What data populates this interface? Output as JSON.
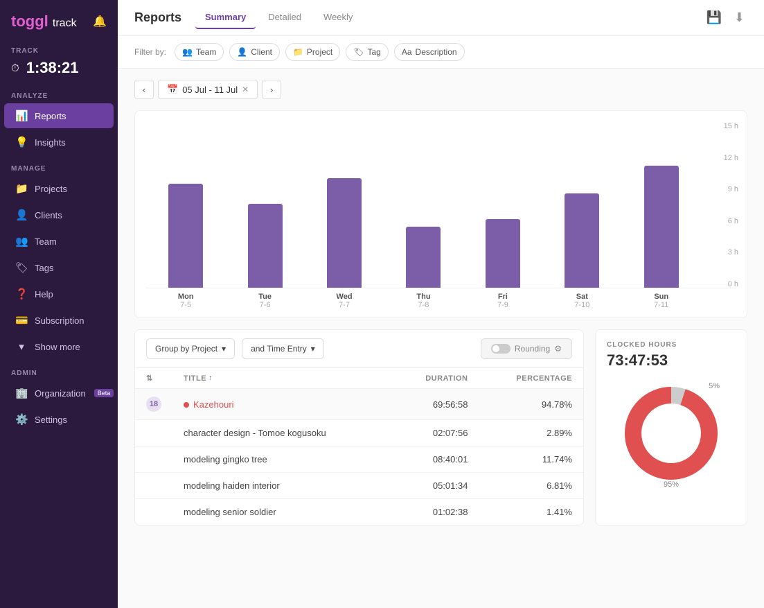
{
  "app": {
    "logo": "toggl",
    "logo_track": "track"
  },
  "sidebar": {
    "track_label": "TRACK",
    "timer": "1:38:21",
    "analyze_label": "ANALYZE",
    "manage_label": "MANAGE",
    "admin_label": "ADMIN",
    "items": {
      "reports": "Reports",
      "insights": "Insights",
      "projects": "Projects",
      "clients": "Clients",
      "team": "Team",
      "tags": "Tags",
      "help": "Help",
      "subscription": "Subscription",
      "show_more": "Show more",
      "organization": "Organization",
      "organization_badge": "Beta",
      "settings": "Settings"
    }
  },
  "header": {
    "page_title": "Reports",
    "tabs": [
      "Summary",
      "Detailed",
      "Weekly"
    ],
    "active_tab": "Summary"
  },
  "filter_bar": {
    "label": "Filter by:",
    "filters": [
      "Team",
      "Client",
      "Project",
      "Tag",
      "Description"
    ]
  },
  "date_nav": {
    "range": "05 Jul - 11 Jul"
  },
  "chart": {
    "y_labels": [
      "15 h",
      "12 h",
      "9 h",
      "6 h",
      "3 h",
      "0 h"
    ],
    "bars": [
      {
        "day": "Mon",
        "date": "7-5",
        "height_pct": 68
      },
      {
        "day": "Tue",
        "date": "7-6",
        "height_pct": 55
      },
      {
        "day": "Wed",
        "date": "7-7",
        "height_pct": 72
      },
      {
        "day": "Thu",
        "date": "7-8",
        "height_pct": 40
      },
      {
        "day": "Fri",
        "date": "7-9",
        "height_pct": 45
      },
      {
        "day": "Sat",
        "date": "7-10",
        "height_pct": 62
      },
      {
        "day": "Sun",
        "date": "7-11",
        "height_pct": 80
      }
    ]
  },
  "table": {
    "group_by": "Group by Project",
    "time_entry": "and Time Entry",
    "rounding": "Rounding",
    "columns": {
      "title": "TITLE",
      "duration": "DURATION",
      "percentage": "PERCENTAGE"
    },
    "rows": [
      {
        "type": "project",
        "count": "18",
        "name": "Kazehouri",
        "duration": "69:56:58",
        "percentage": "94.78%"
      },
      {
        "type": "entry",
        "name": "character design - Tomoe kogusoku",
        "duration": "02:07:56",
        "percentage": "2.89%"
      },
      {
        "type": "entry",
        "name": "modeling gingko tree",
        "duration": "08:40:01",
        "percentage": "11.74%"
      },
      {
        "type": "entry",
        "name": "modeling haiden interior",
        "duration": "05:01:34",
        "percentage": "6.81%"
      },
      {
        "type": "entry",
        "name": "modeling senior soldier",
        "duration": "01:02:38",
        "percentage": "1.41%"
      }
    ]
  },
  "clocked": {
    "label": "CLOCKED HOURS",
    "time": "73:47:53",
    "donut": {
      "pct_small": "5%",
      "pct_large": "95%",
      "large_color": "#e05050",
      "small_color": "#cccccc"
    }
  }
}
